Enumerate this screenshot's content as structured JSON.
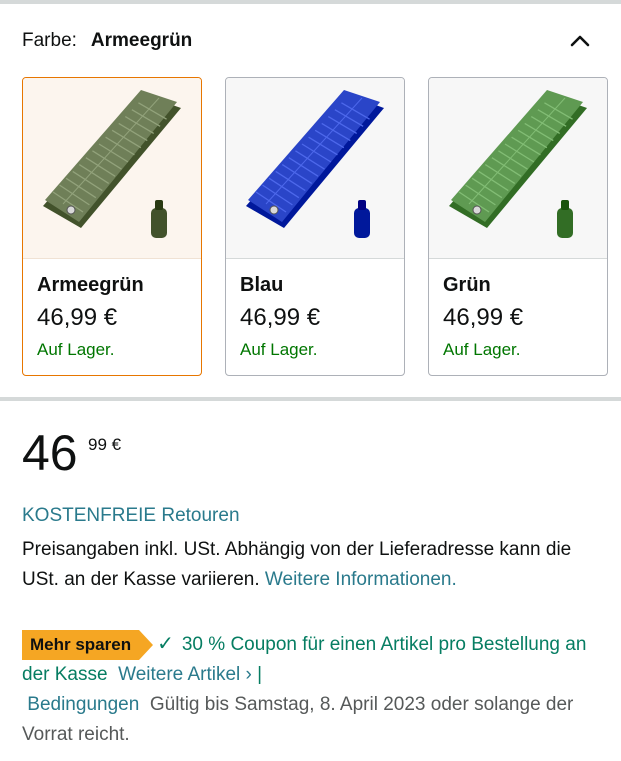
{
  "color_selector": {
    "label": "Farbe:",
    "selected": "Armeegrün",
    "collapse_icon": "chevron-up-icon"
  },
  "variants": [
    {
      "name": "Armeegrün",
      "price": "46,99 €",
      "stock": "Auf Lager.",
      "color": "#6f7f58",
      "selected": true
    },
    {
      "name": "Blau",
      "price": "46,99 €",
      "stock": "Auf Lager.",
      "color": "#2a45c8",
      "selected": false
    },
    {
      "name": "Grün",
      "price": "46,99 €",
      "stock": "Auf Lager.",
      "color": "#5f9a52",
      "selected": false
    }
  ],
  "price": {
    "whole": "46",
    "fraction": "99",
    "currency": "€"
  },
  "returns_link": "KOSTENFREIE Retouren",
  "tax_note": {
    "text": "Preisangaben inkl. USt. Abhängig von der Lieferadresse kann die USt. an der Kasse variieren.",
    "link": "Weitere Informationen."
  },
  "coupon": {
    "badge": "Mehr sparen",
    "check_icon": "checkmark-icon",
    "text": "30 % Coupon für einen Artikel pro Bestellung an der Kasse",
    "more_items_link": "Weitere Artikel ›",
    "separator": "|",
    "terms_link": "Bedingungen",
    "validity": "Gültig bis Samstag, 8. April 2023 oder solange der Vorrat reicht."
  },
  "colors": {
    "link": "#2a7a8c",
    "in_stock": "#007600",
    "coupon_green": "#067d62",
    "badge": "#f5a623",
    "selected_border": "#e77600"
  }
}
